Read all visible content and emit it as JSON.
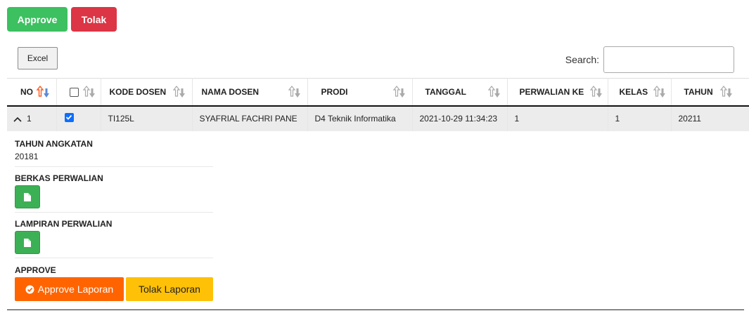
{
  "actions": {
    "approve_label": "Approve",
    "tolak_label": "Tolak"
  },
  "toolbar": {
    "excel_label": "Excel",
    "search_label": "Search:",
    "search_value": ""
  },
  "table": {
    "headers": [
      "NO",
      "",
      "KODE DOSEN",
      "NAMA DOSEN",
      "PRODI",
      "TANGGAL",
      "PERWALIAN KE",
      "KELAS",
      "TAHUN"
    ],
    "row": {
      "no": "1",
      "checked": true,
      "kode_dosen": "TI125L",
      "nama_dosen": "SYAFRIAL FACHRI PANE",
      "prodi": "D4 Teknik Informatika",
      "tanggal": "2021-10-29 11:34:23",
      "perwalian_ke": "1",
      "kelas": "1",
      "tahun": "20211"
    }
  },
  "detail": {
    "tahun_angkatan_label": "TAHUN ANGKATAN",
    "tahun_angkatan_value": "20181",
    "berkas_label": "BERKAS PERWALIAN",
    "lampiran_label": "LAMPIRAN PERWALIAN",
    "approve_label": "APPROVE",
    "approve_laporan_label": "Approve Laporan",
    "tolak_laporan_label": "Tolak Laporan"
  },
  "colors": {
    "approve": "#3cc060",
    "tolak": "#dc3545",
    "approve_laporan": "#ff6400",
    "tolak_laporan": "#ffc107",
    "file_button": "#3cb054",
    "sort_active": "#ff5a1f",
    "sort_active_down": "#5b8ad6"
  }
}
